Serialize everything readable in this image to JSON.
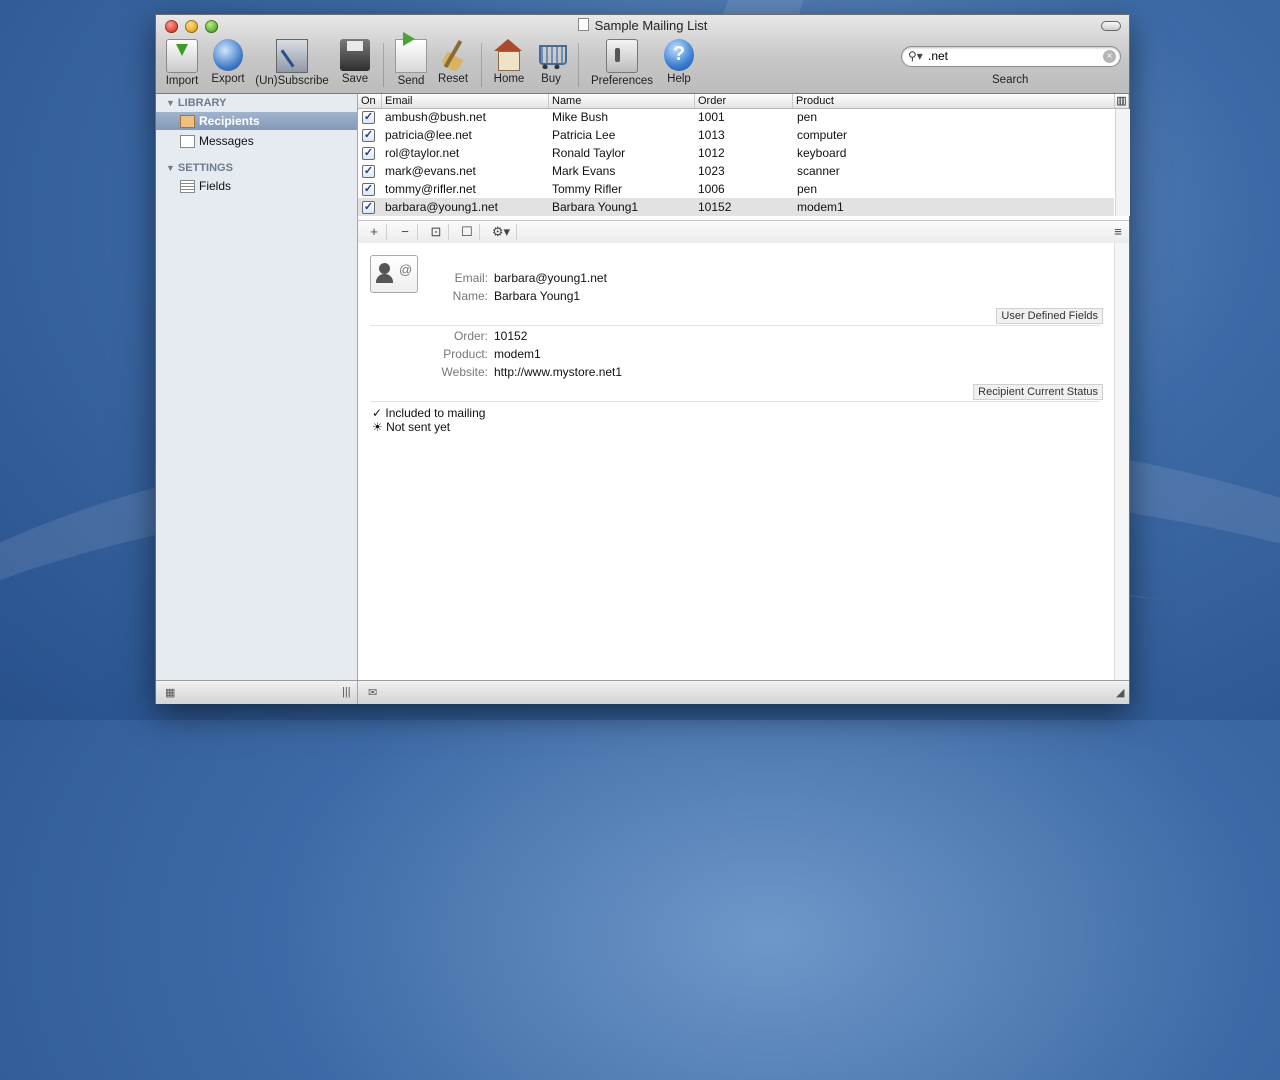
{
  "window": {
    "title": "Sample Mailing List"
  },
  "toolbar": {
    "import": "Import",
    "export": "Export",
    "unsubscribe": "(Un)Subscribe",
    "save": "Save",
    "send": "Send",
    "reset": "Reset",
    "home": "Home",
    "buy": "Buy",
    "preferences": "Preferences",
    "help": "Help",
    "help_glyph": "?"
  },
  "search": {
    "value": ".net",
    "label": "Search"
  },
  "sidebar": {
    "library_header": "LIBRARY",
    "settings_header": "SETTINGS",
    "items": [
      {
        "label": "Recipients",
        "selected": true
      },
      {
        "label": "Messages",
        "selected": false
      },
      {
        "label": "Fields",
        "selected": false
      }
    ]
  },
  "table": {
    "columns": [
      "On",
      "Email",
      "Name",
      "Order",
      "Product"
    ],
    "rows": [
      {
        "on": true,
        "email": "ambush@bush.net",
        "name": "Mike Bush",
        "order": "1001",
        "product": "pen"
      },
      {
        "on": true,
        "email": "patricia@lee.net",
        "name": "Patricia Lee",
        "order": "1013",
        "product": "computer"
      },
      {
        "on": true,
        "email": "rol@taylor.net",
        "name": "Ronald Taylor",
        "order": "1012",
        "product": "keyboard"
      },
      {
        "on": true,
        "email": "mark@evans.net",
        "name": "Mark Evans",
        "order": "1023",
        "product": "scanner"
      },
      {
        "on": true,
        "email": "tommy@rifler.net",
        "name": "Tommy Rifler",
        "order": "1006",
        "product": "pen"
      },
      {
        "on": true,
        "email": "barbara@young1.net",
        "name": "Barbara Young1",
        "order": "10152",
        "product": "modem1"
      }
    ],
    "selected_row": 5,
    "check_glyph": "✓"
  },
  "table_toolbar": {
    "add": "+",
    "remove": "−",
    "edit": "⊡",
    "toggle": "☐",
    "action": "⚙▾",
    "menu": "≡"
  },
  "detail": {
    "labels": {
      "email": "Email:",
      "name": "Name:",
      "order": "Order:",
      "product": "Product:",
      "website": "Website:"
    },
    "email": "barbara@young1.net",
    "name": "Barbara Young1",
    "order": "10152",
    "product": "modem1",
    "website": "http://www.mystore.net1",
    "user_defined_fields": "User Defined Fields",
    "recipient_status": "Recipient Current Status",
    "status_lines": [
      "✓ Included to mailing",
      "☀ Not sent yet"
    ]
  },
  "icons": {
    "search": "search-icon",
    "clear": "clear-icon",
    "triangle": "disclosure-triangle-icon",
    "grid": "grid-icon",
    "splitter": "splitter-icon",
    "envelope": "envelope-icon",
    "resize": "resize-grip-icon"
  },
  "glyphs": {
    "mag": "⚲▾",
    "clear": "×",
    "tri": "▼",
    "grid": "▦",
    "split": "|||",
    "env": "✉",
    "grip": "◢",
    "colmenu": "▥"
  }
}
